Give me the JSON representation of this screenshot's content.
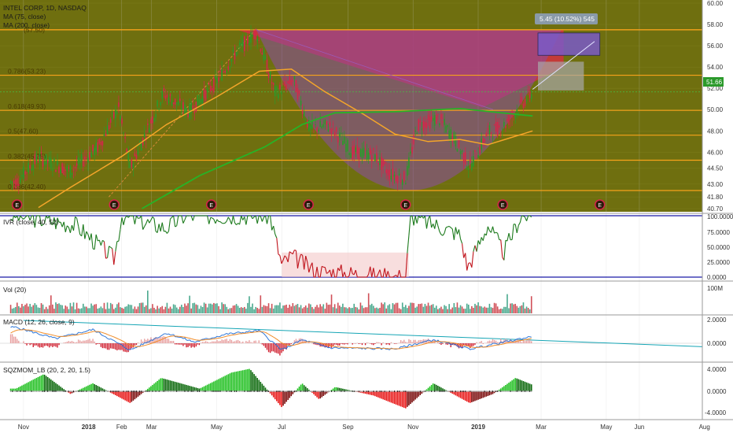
{
  "colors": {
    "price_bg": "#6f6f0f",
    "fib_line": "#f7a21b",
    "bowl_fill": "#8a4da6",
    "red_zone": "#e8254a",
    "ma75": "#f4a52a",
    "ma200": "#27b327",
    "candle_up": "#2b9a2b",
    "candle_down": "#d6254a",
    "ivr_up": "#1c7a1c",
    "ivr_down": "#c0131b",
    "macd_line": "#2a74d8",
    "signal_line": "#f08a24",
    "trendline": "#15a5b5",
    "earnings_marker": "#d6254a",
    "box_blue": "#7a5ac8",
    "box_grey": "#a8a8a8"
  },
  "header": {
    "title": "INTEL CORP, 1D, NASDAQ",
    "ma75": "MA (75, close)",
    "ma200": "MA (200, close)"
  },
  "projection_label": "5.45 (10.52%) 545",
  "last_price": "51.66",
  "earnings_label": "E",
  "panels": {
    "ivr": {
      "label": "IVR (close, 40, 52)",
      "ticks": [
        "100.0000",
        "75.0000",
        "50.0000",
        "25.0000",
        "0.0000"
      ]
    },
    "vol": {
      "label": "Vol (20)",
      "ticks": [
        "100M"
      ]
    },
    "macd": {
      "label": "MACD (12, 26, close, 9)",
      "ticks": [
        "2.0000",
        "0.0000"
      ]
    },
    "sqz": {
      "label": "SQZMOM_LB (20, 2, 20, 1.5)",
      "ticks": [
        "4.0000",
        "0.0000",
        "-4.0000"
      ]
    }
  },
  "chart_data": {
    "type": "candlestick",
    "symbol": "INTEL CORP",
    "interval": "1D",
    "exchange": "NASDAQ",
    "x_ticks": [
      "Nov",
      "2018",
      "Feb",
      "Mar",
      "May",
      "Jul",
      "Sep",
      "Nov",
      "2019",
      "Mar",
      "May",
      "Jun",
      "Aug"
    ],
    "price_ticks": [
      "60.00",
      "58.00",
      "56.00",
      "54.00",
      "52.00",
      "50.00",
      "48.00",
      "46.00",
      "44.50",
      "43.00",
      "41.80",
      "40.70"
    ],
    "price_range": [
      40.7,
      60.0
    ],
    "fib_levels": [
      {
        "label": "0.786(53.23)",
        "value": 53.23
      },
      {
        "label": "0.618(49.93)",
        "value": 49.93
      },
      {
        "label": "0.5(47.60)",
        "value": 47.6
      },
      {
        "label": "0.382(45.25)",
        "value": 45.25
      },
      {
        "label": "0.236(42.40)",
        "value": 42.4
      }
    ],
    "fib_top": 57.5,
    "close_path": [
      [
        "2017-10-25",
        43.2
      ],
      [
        "2017-11-15",
        45.5
      ],
      [
        "2017-12-15",
        44.2
      ],
      [
        "2018-01-10",
        46.5
      ],
      [
        "2018-01-29",
        50.2
      ],
      [
        "2018-02-09",
        44.5
      ],
      [
        "2018-03-12",
        51.5
      ],
      [
        "2018-04-05",
        49.8
      ],
      [
        "2018-04-30",
        52.5
      ],
      [
        "2018-05-20",
        55.5
      ],
      [
        "2018-06-07",
        57.3
      ],
      [
        "2018-06-25",
        51.5
      ],
      [
        "2018-07-12",
        52.8
      ],
      [
        "2018-07-27",
        48.2
      ],
      [
        "2018-08-15",
        48.5
      ],
      [
        "2018-09-05",
        46.0
      ],
      [
        "2018-09-25",
        45.8
      ],
      [
        "2018-10-10",
        44.0
      ],
      [
        "2018-10-25",
        43.5
      ],
      [
        "2018-11-05",
        48.5
      ],
      [
        "2018-11-25",
        49.2
      ],
      [
        "2018-12-10",
        47.2
      ],
      [
        "2018-12-24",
        44.6
      ],
      [
        "2019-01-10",
        47.8
      ],
      [
        "2019-01-25",
        48.5
      ],
      [
        "2019-02-08",
        50.2
      ],
      [
        "2019-02-21",
        51.66
      ]
    ],
    "ma75_path": [
      [
        "2017-11-15",
        40.8
      ],
      [
        "2017-12-15",
        42.7
      ],
      [
        "2018-02-01",
        45.6
      ],
      [
        "2018-03-15",
        48.6
      ],
      [
        "2018-05-01",
        51.2
      ],
      [
        "2018-06-10",
        53.6
      ],
      [
        "2018-07-10",
        53.8
      ],
      [
        "2018-08-10",
        51.7
      ],
      [
        "2018-09-15",
        49.6
      ],
      [
        "2018-10-15",
        47.7
      ],
      [
        "2018-11-15",
        47.0
      ],
      [
        "2018-12-15",
        47.2
      ],
      [
        "2019-01-10",
        46.7
      ],
      [
        "2019-02-21",
        48.0
      ]
    ],
    "ma200_path": [
      [
        "2018-02-20",
        40.7
      ],
      [
        "2018-04-15",
        43.8
      ],
      [
        "2018-06-15",
        46.5
      ],
      [
        "2018-07-20",
        48.6
      ],
      [
        "2018-08-20",
        49.7
      ],
      [
        "2018-10-15",
        49.8
      ],
      [
        "2018-12-15",
        50.1
      ],
      [
        "2019-02-21",
        49.4
      ]
    ],
    "earnings_dates": [
      "2017-10-26",
      "2018-01-25",
      "2018-04-26",
      "2018-07-26",
      "2018-10-25",
      "2019-01-24",
      "2019-04-25"
    ],
    "ivr_path": [
      [
        "2017-10-25",
        100
      ],
      [
        "2017-12-20",
        85
      ],
      [
        "2018-01-25",
        30
      ],
      [
        "2018-02-01",
        100
      ],
      [
        "2018-03-15",
        80
      ],
      [
        "2018-04-01",
        100
      ],
      [
        "2018-06-20",
        100
      ],
      [
        "2018-07-01",
        20
      ],
      [
        "2018-07-10",
        35
      ],
      [
        "2018-08-01",
        10
      ],
      [
        "2018-10-25",
        0
      ],
      [
        "2018-10-30",
        100
      ],
      [
        "2018-12-15",
        70
      ],
      [
        "2018-12-22",
        15
      ],
      [
        "2019-01-10",
        85
      ],
      [
        "2019-01-25",
        40
      ],
      [
        "2019-02-10",
        100
      ],
      [
        "2019-02-21",
        100
      ]
    ],
    "volume_max": "100M",
    "macd_range": [
      -1.0,
      2.5
    ],
    "macd_path": [
      [
        "2017-10-25",
        1.4
      ],
      [
        "2017-12-01",
        0.4
      ],
      [
        "2018-01-05",
        1.2
      ],
      [
        "2018-02-09",
        -0.6
      ],
      [
        "2018-03-15",
        0.9
      ],
      [
        "2018-04-10",
        0.1
      ],
      [
        "2018-05-10",
        0.8
      ],
      [
        "2018-06-10",
        1.1
      ],
      [
        "2018-07-01",
        -0.6
      ],
      [
        "2018-07-20",
        0.3
      ],
      [
        "2018-08-15",
        -0.4
      ],
      [
        "2018-10-15",
        -0.5
      ],
      [
        "2018-11-20",
        0.3
      ],
      [
        "2018-12-24",
        -0.5
      ],
      [
        "2019-02-21",
        0.6
      ]
    ],
    "sqz_range": [
      -4.5,
      5.0
    ],
    "sqz_path": [
      [
        "2017-10-25",
        0.5
      ],
      [
        "2017-11-20",
        3.2
      ],
      [
        "2017-12-15",
        -0.5
      ],
      [
        "2018-01-05",
        1.5
      ],
      [
        "2018-02-09",
        -2.2
      ],
      [
        "2018-03-10",
        2.5
      ],
      [
        "2018-04-15",
        0.5
      ],
      [
        "2018-05-15",
        3.5
      ],
      [
        "2018-06-01",
        4.2
      ],
      [
        "2018-07-01",
        -3.0
      ],
      [
        "2018-07-20",
        1.5
      ],
      [
        "2018-08-05",
        -1.5
      ],
      [
        "2018-08-20",
        0.8
      ],
      [
        "2018-09-25",
        -0.8
      ],
      [
        "2018-10-25",
        -3.2
      ],
      [
        "2018-11-20",
        1.5
      ],
      [
        "2018-12-24",
        -2.2
      ],
      [
        "2019-01-15",
        -0.5
      ],
      [
        "2019-02-05",
        2.5
      ],
      [
        "2019-02-21",
        1.2
      ]
    ]
  }
}
